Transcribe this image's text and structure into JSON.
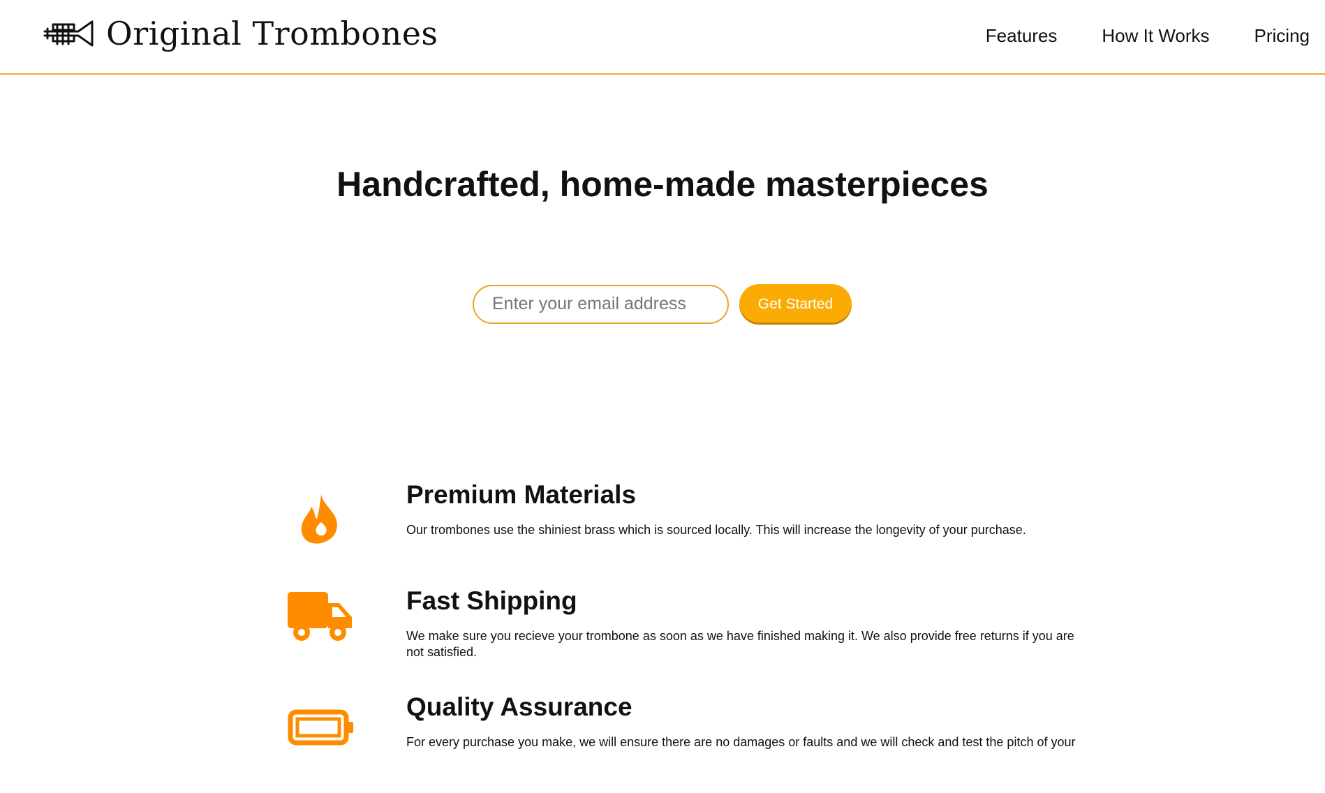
{
  "header": {
    "logo_text": "Original Trombones",
    "nav": [
      {
        "label": "Features"
      },
      {
        "label": "How It Works"
      },
      {
        "label": "Pricing"
      }
    ]
  },
  "hero": {
    "title": "Handcrafted, home-made masterpieces",
    "email_placeholder": "Enter your email address",
    "cta_label": "Get Started"
  },
  "features": [
    {
      "icon": "fire-icon",
      "title": "Premium Materials",
      "description": "Our trombones use the shiniest brass which is sourced locally. This will increase the longevity of your purchase."
    },
    {
      "icon": "truck-icon",
      "title": "Fast Shipping",
      "description": "We make sure you recieve your trombone as soon as we have finished making it. We also provide free returns if you are not satisfied."
    },
    {
      "icon": "battery-icon",
      "title": "Quality Assurance",
      "description": "For every purchase you make, we will ensure there are no damages or faults and we will check and test the pitch of your"
    }
  ],
  "colors": {
    "accent": "#fbac04",
    "icon": "#ff8c00",
    "header_border": "#f0a830"
  }
}
